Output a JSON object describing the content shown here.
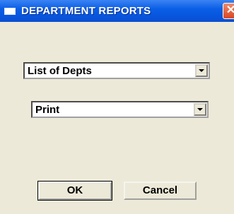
{
  "window": {
    "title": "DEPARTMENT REPORTS",
    "close_glyph": "✕"
  },
  "report_select": {
    "selected": "List of Depts",
    "icon": "chevron-down-icon"
  },
  "output_select": {
    "selected": "Print",
    "icon": "chevron-down-icon"
  },
  "buttons": {
    "ok_label": "OK",
    "cancel_label": "Cancel"
  },
  "colors": {
    "titlebar": "#0855dd",
    "window_bg": "#ece9d8",
    "close": "#d9461f"
  }
}
